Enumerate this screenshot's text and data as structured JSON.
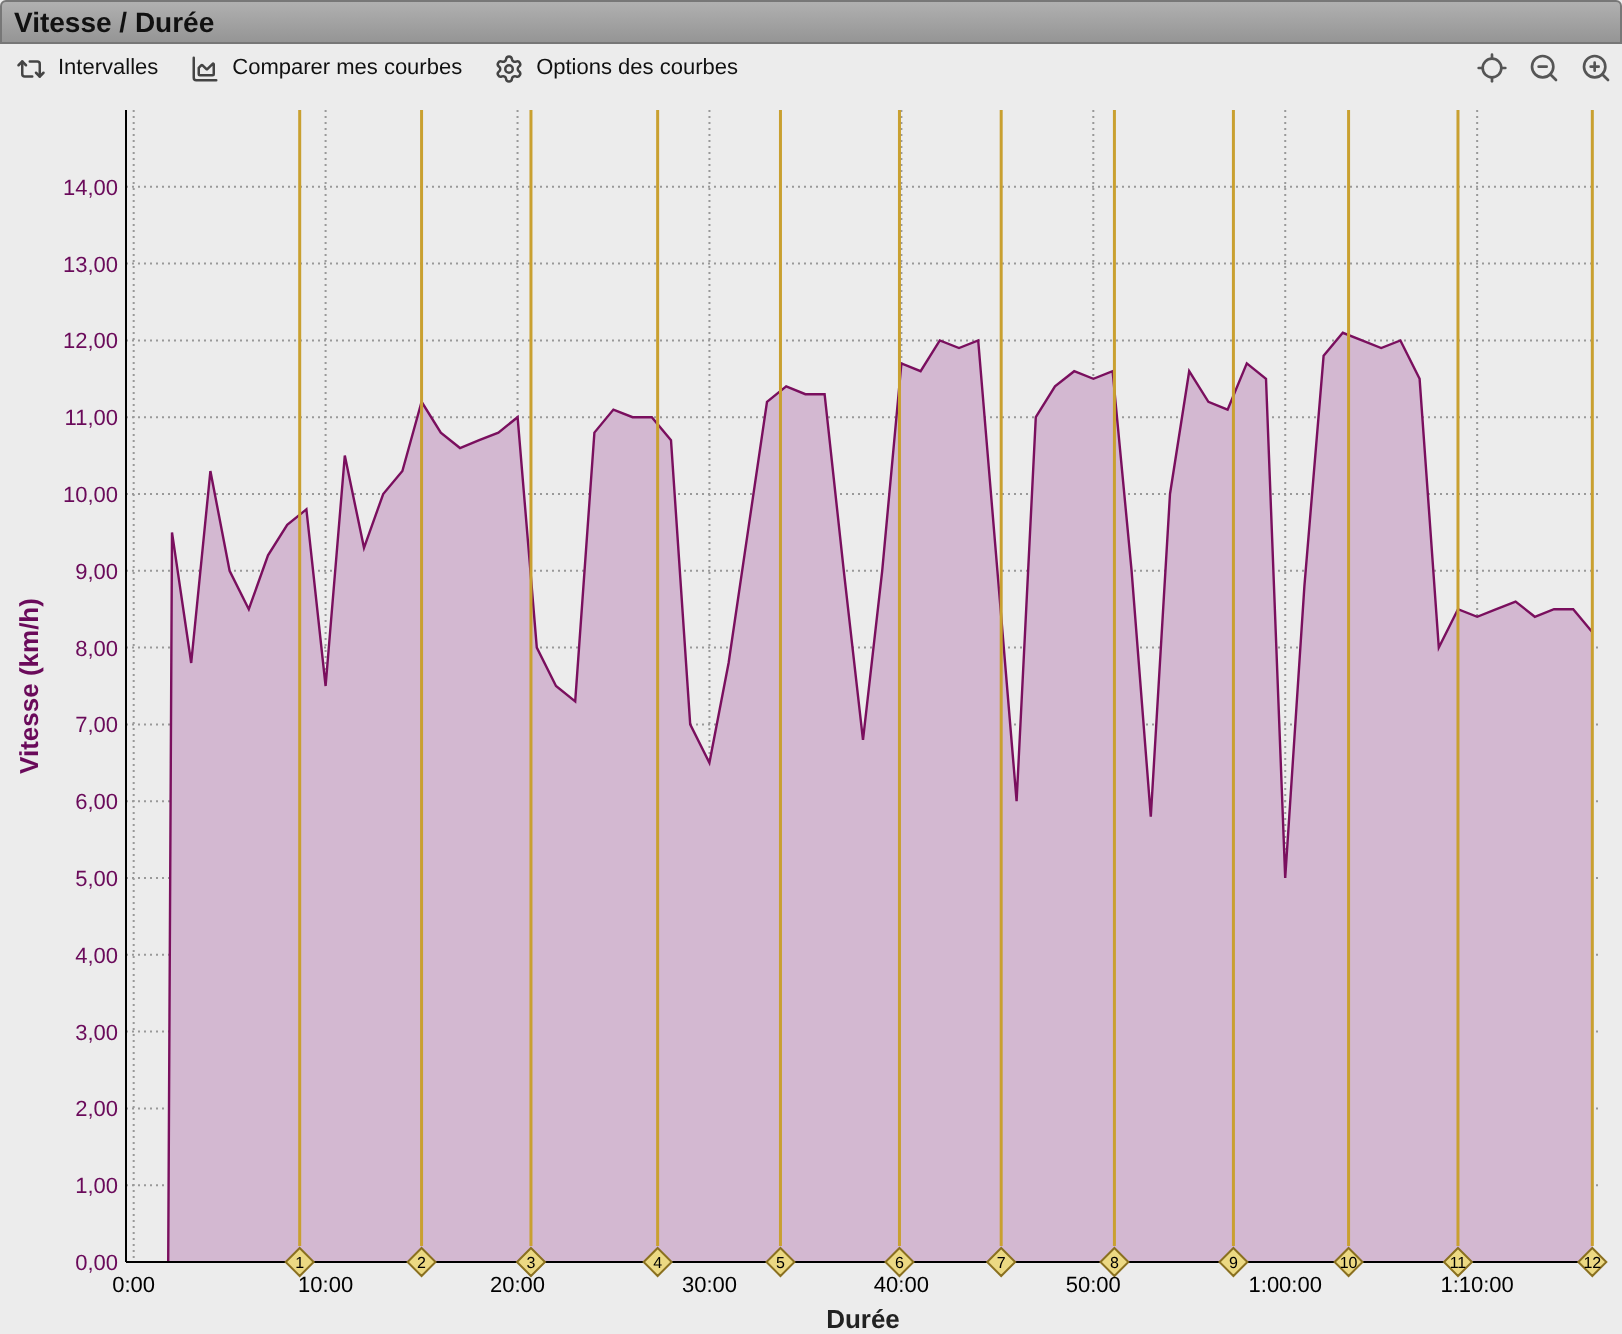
{
  "window": {
    "title": "Vitesse / Durée"
  },
  "toolbar": {
    "buttons": [
      {
        "label": "Intervalles"
      },
      {
        "label": "Comparer mes courbes"
      },
      {
        "label": "Options des courbes"
      }
    ]
  },
  "chart": {
    "chart_data": {
      "type": "area",
      "xlabel": "Durée",
      "ylabel": "Vitesse (km/h)",
      "x": [
        1.8,
        2,
        3,
        4,
        5,
        6,
        7,
        8,
        9,
        10,
        11,
        12,
        13,
        14,
        15,
        16,
        17,
        18,
        19,
        20,
        21,
        22,
        23,
        24,
        25,
        26,
        27,
        28,
        29,
        30,
        31,
        32,
        33,
        34,
        35,
        36,
        37,
        38,
        39,
        40,
        41,
        42,
        43,
        44,
        45,
        46,
        47,
        48,
        49,
        50,
        51,
        52,
        53,
        54,
        55,
        56,
        57,
        58,
        59,
        60,
        61,
        62,
        63,
        64,
        65,
        66,
        67,
        68,
        69,
        70,
        71,
        72,
        73,
        74,
        75,
        76
      ],
      "series": [
        {
          "color": "#7a0f5e",
          "values": [
            0,
            9.5,
            7.8,
            10.3,
            9.0,
            8.5,
            9.2,
            9.6,
            9.8,
            7.5,
            10.5,
            9.3,
            10.0,
            10.3,
            11.2,
            10.8,
            10.6,
            10.7,
            10.8,
            11.0,
            8.0,
            7.5,
            7.3,
            10.8,
            11.1,
            11.0,
            11.0,
            10.7,
            7.0,
            6.5,
            7.8,
            9.5,
            11.2,
            11.4,
            11.3,
            11.3,
            9.0,
            6.8,
            9.0,
            11.7,
            11.6,
            12.0,
            11.9,
            12.0,
            9.0,
            6.0,
            11.0,
            11.4,
            11.6,
            11.5,
            11.6,
            9.0,
            5.8,
            10.0,
            11.6,
            11.2,
            11.1,
            11.7,
            11.5,
            5.0,
            8.8,
            11.8,
            12.1,
            12.0,
            11.9,
            12.0,
            11.5,
            8.0,
            8.5,
            8.4,
            8.5,
            8.6,
            8.4,
            8.5,
            8.5,
            8.2
          ]
        }
      ],
      "xlim": [
        -0.4,
        76.4
      ],
      "ylim": [
        0,
        15
      ],
      "grid": true,
      "xticks": [
        {
          "value": 0,
          "label": "0:00"
        },
        {
          "value": 10,
          "label": "10:00"
        },
        {
          "value": 20,
          "label": "20:00"
        },
        {
          "value": 30,
          "label": "30:00"
        },
        {
          "value": 40,
          "label": "40:00"
        },
        {
          "value": 50,
          "label": "50:00"
        },
        {
          "value": 60,
          "label": "1:00:00"
        },
        {
          "value": 70,
          "label": "1:10:00"
        }
      ],
      "yticks": [
        {
          "value": 0,
          "label": "0,00"
        },
        {
          "value": 1,
          "label": "1,00"
        },
        {
          "value": 2,
          "label": "2,00"
        },
        {
          "value": 3,
          "label": "3,00"
        },
        {
          "value": 4,
          "label": "4,00"
        },
        {
          "value": 5,
          "label": "5,00"
        },
        {
          "value": 6,
          "label": "6,00"
        },
        {
          "value": 7,
          "label": "7,00"
        },
        {
          "value": 8,
          "label": "8,00"
        },
        {
          "value": 9,
          "label": "9,00"
        },
        {
          "value": 10,
          "label": "10,00"
        },
        {
          "value": 11,
          "label": "11,00"
        },
        {
          "value": 12,
          "label": "12,00"
        },
        {
          "value": 13,
          "label": "13,00"
        },
        {
          "value": 14,
          "label": "14,00"
        }
      ],
      "ref_lines": [
        {
          "axis": "x",
          "value": 8.65
        },
        {
          "axis": "x",
          "value": 15.0
        },
        {
          "axis": "x",
          "value": 20.7
        },
        {
          "axis": "x",
          "value": 27.3
        },
        {
          "axis": "x",
          "value": 33.7
        },
        {
          "axis": "x",
          "value": 39.9
        },
        {
          "axis": "x",
          "value": 45.2
        },
        {
          "axis": "x",
          "value": 51.1
        },
        {
          "axis": "x",
          "value": 57.3
        },
        {
          "axis": "x",
          "value": 63.3
        },
        {
          "axis": "x",
          "value": 69.0
        },
        {
          "axis": "x",
          "value": 76.0
        }
      ]
    },
    "interval_markers": [
      {
        "label": "1"
      },
      {
        "label": "2"
      },
      {
        "label": "3"
      },
      {
        "label": "4"
      },
      {
        "label": "5"
      },
      {
        "label": "6"
      },
      {
        "label": "7"
      },
      {
        "label": "8"
      },
      {
        "label": "9"
      },
      {
        "label": "10"
      },
      {
        "label": "11"
      },
      {
        "label": "12"
      }
    ]
  }
}
